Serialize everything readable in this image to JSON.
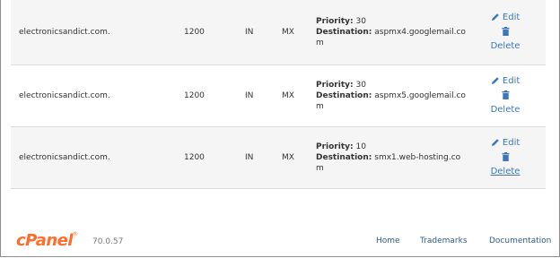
{
  "records": [
    {
      "name": "electronicsandict.com.",
      "ttl": "1200",
      "class": "IN",
      "type": "MX",
      "priority_label": "Priority:",
      "priority": "30",
      "destination_label": "Destination:",
      "destination_line1": "aspmx4.googlemail.co",
      "destination_line2": "m",
      "edit": "Edit",
      "delete": "Delete"
    },
    {
      "name": "electronicsandict.com.",
      "ttl": "1200",
      "class": "IN",
      "type": "MX",
      "priority_label": "Priority:",
      "priority": "30",
      "destination_label": "Destination:",
      "destination_line1": "aspmx5.googlemail.co",
      "destination_line2": "m",
      "edit": "Edit",
      "delete": "Delete"
    },
    {
      "name": "electronicsandict.com.",
      "ttl": "1200",
      "class": "IN",
      "type": "MX",
      "priority_label": "Priority:",
      "priority": "10",
      "destination_label": "Destination:",
      "destination_line1": "smx1.web-hosting.co",
      "destination_line2": "m",
      "edit": "Edit",
      "delete": "Delete"
    }
  ],
  "footer": {
    "logo": "cPanel",
    "version": "70.0.57",
    "links": {
      "home": "Home",
      "trademarks": "Trademarks",
      "documentation": "Documentation"
    }
  },
  "icons": {
    "edit": "pencil-icon",
    "delete": "trash-icon"
  },
  "colors": {
    "link": "#3b78b8",
    "brand": "#ff6c2c",
    "row_alt": "#f5f5f5"
  }
}
